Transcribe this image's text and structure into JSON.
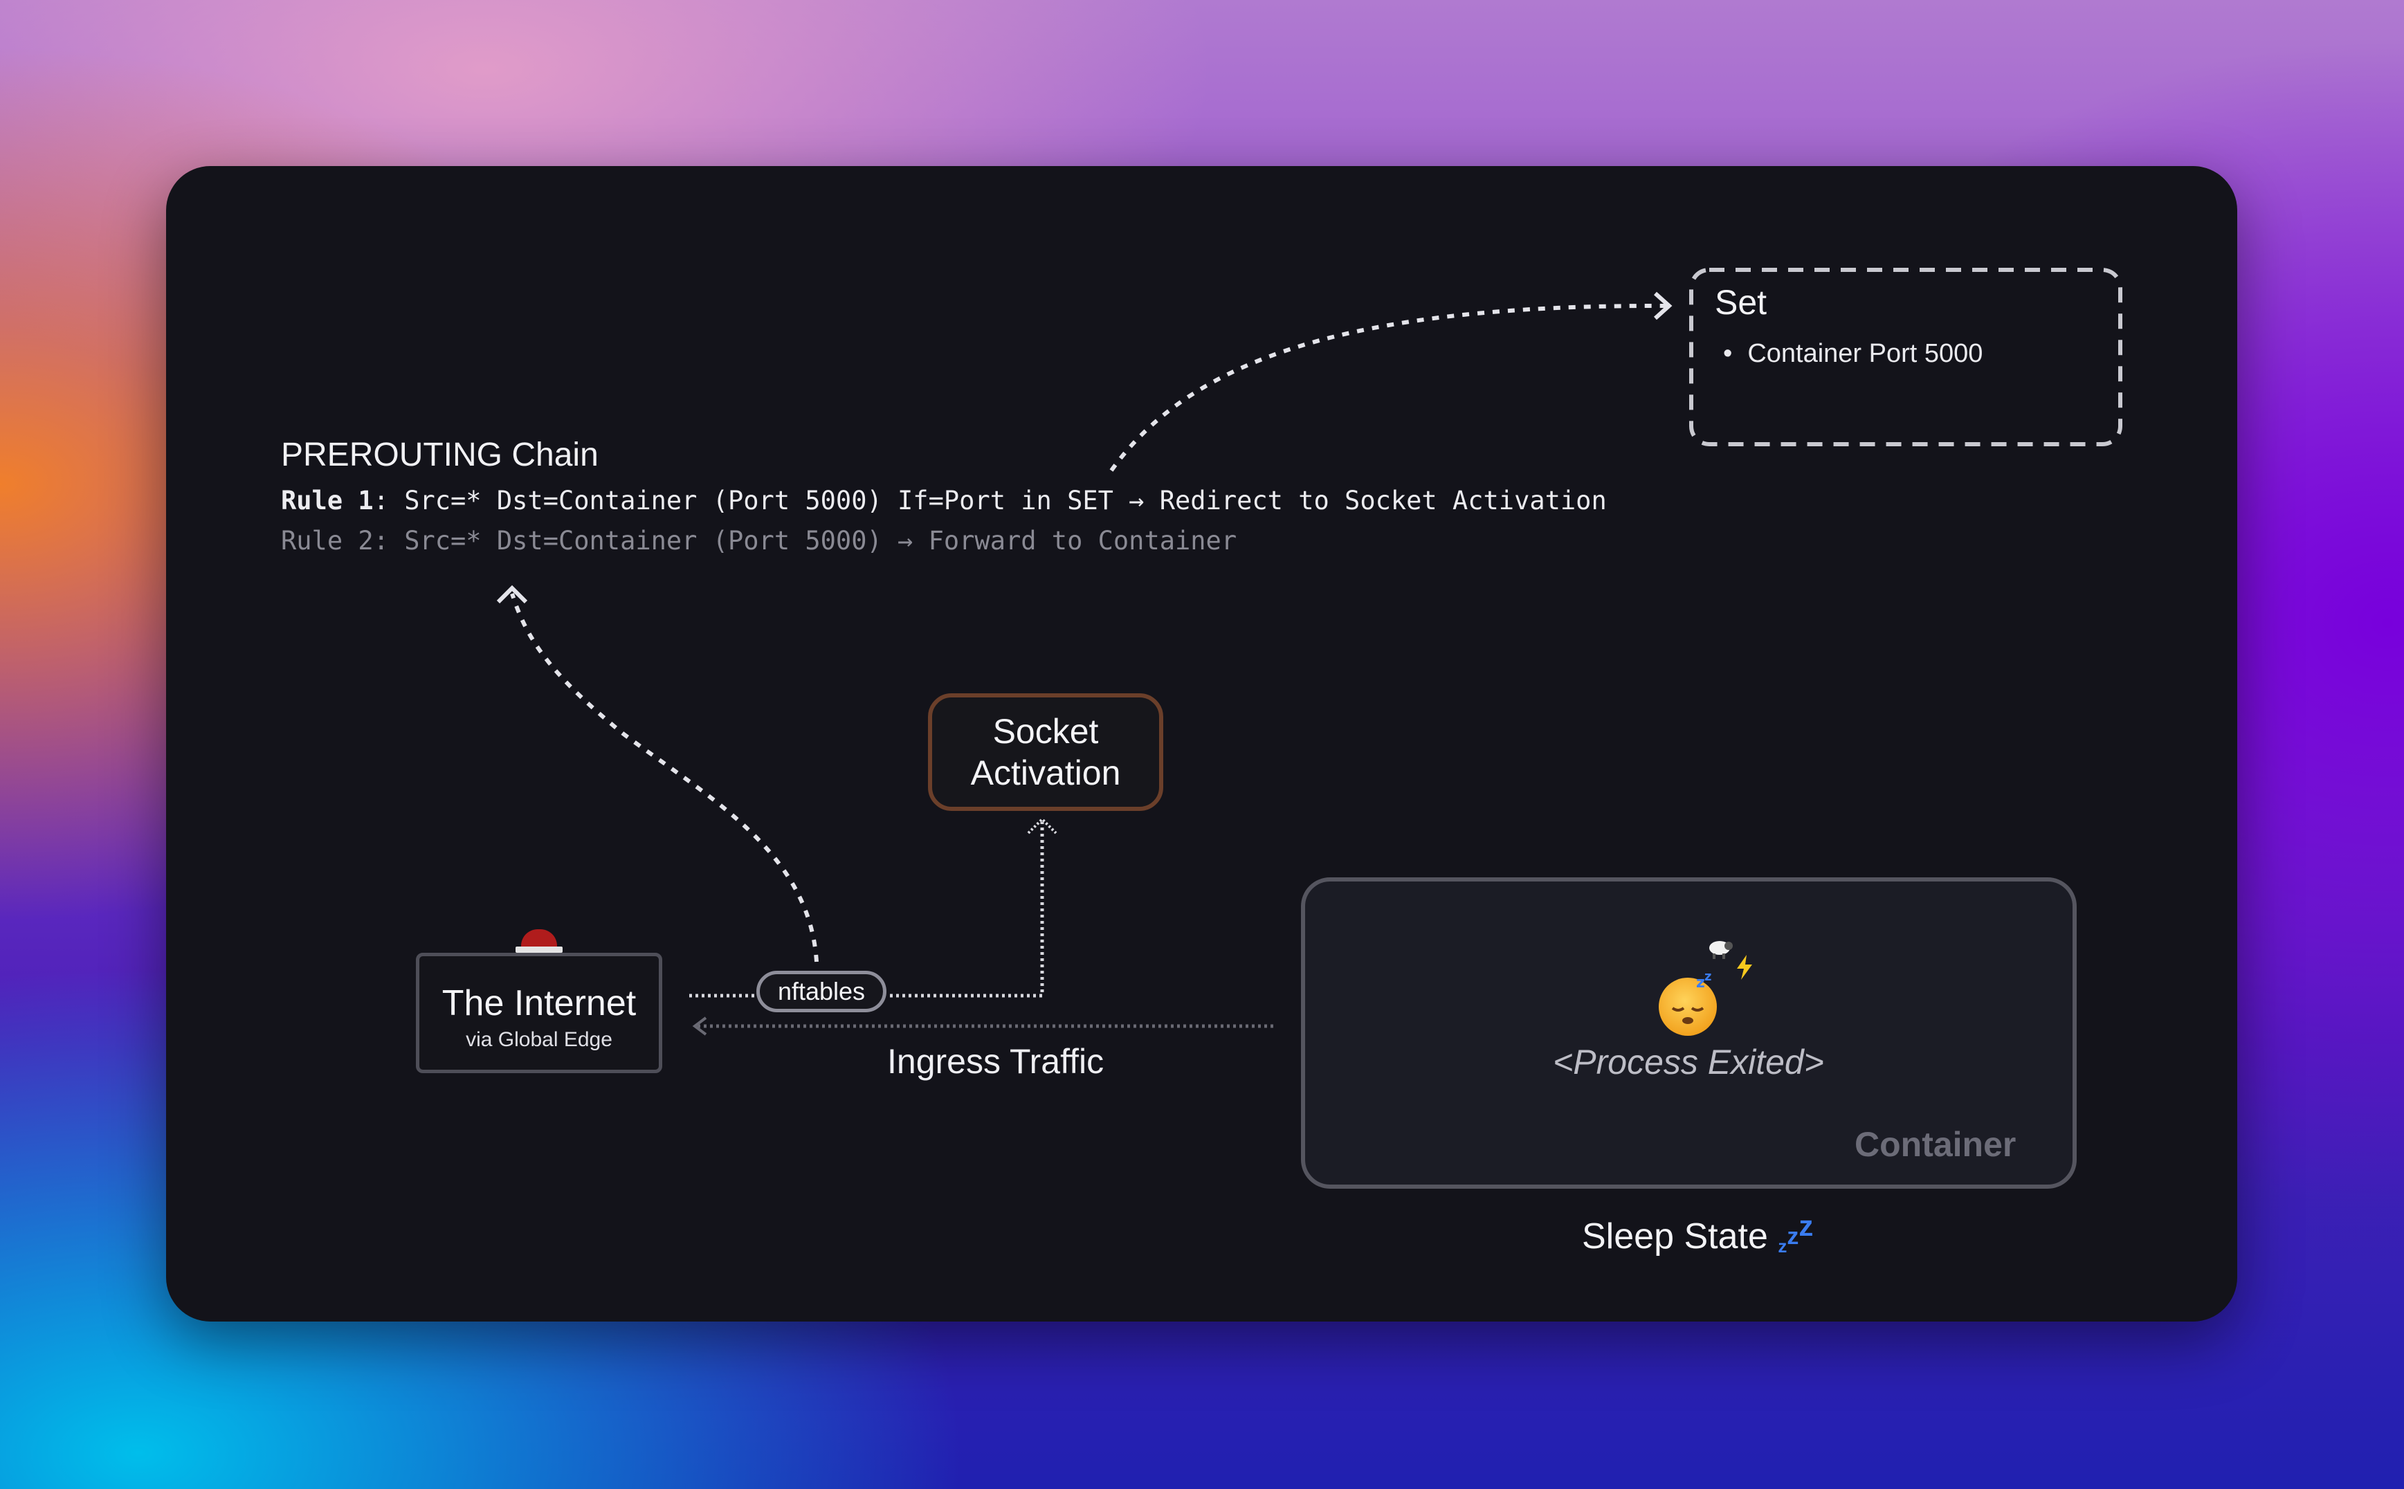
{
  "chain": {
    "title": "PREROUTING Chain",
    "rule1_label": "Rule 1",
    "rule1_text": ": Src=* Dst=Container (Port 5000) If=Port in SET → Redirect to Socket Activation",
    "rule2_text": "Rule 2: Src=* Dst=Container (Port 5000) → Forward to Container"
  },
  "set": {
    "title": "Set",
    "items": [
      "Container Port 5000"
    ]
  },
  "internet": {
    "title": "The Internet",
    "subtitle": "via Global Edge",
    "icon": "siren-icon"
  },
  "nftables": {
    "label": "nftables"
  },
  "socket": {
    "label": "Socket Activation"
  },
  "ingress": {
    "label": "Ingress Traffic"
  },
  "container": {
    "label": "Container",
    "status": "<Process Exited>",
    "icons": [
      "sleeping-face-icon",
      "sheep-icon",
      "lightning-icon"
    ]
  },
  "sleep": {
    "label": "Sleep State"
  },
  "colors": {
    "panel": "#13131a",
    "socket_border": "#6b3f2a",
    "siren": "#b01c1c",
    "zzz": "#3a7cf0"
  }
}
